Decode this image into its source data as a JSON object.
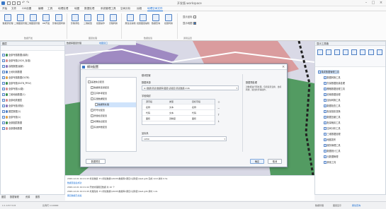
{
  "window": {
    "title": "开发版.workspace"
  },
  "menu": [
    "开始",
    "文件",
    "GIS设置",
    "编辑",
    "工具",
    "地理处理",
    "地图",
    "数据处理",
    "系统管理工具",
    "空间分析",
    "远程",
    "地理空间文件"
  ],
  "ribbon": {
    "buttons": [
      "数据源管理",
      "二维图层管理",
      "三维图层管理",
      "DB开发",
      "影像批量转换",
      "影像调色",
      "三维模型",
      "批量操作",
      "高程转换",
      "属性表编辑",
      "批量图层编辑",
      "数据查询",
      "批量转换"
    ],
    "groups": [
      "数据开发",
      "图层处理",
      "数据加载",
      "通用设置"
    ],
    "checks": [
      {
        "label": "显示坐标",
        "checked": false
      },
      {
        "label": "显示地图",
        "checked": true
      }
    ]
  },
  "left_panel": {
    "title": "图层",
    "items": [
      "全部专题数据(最新)",
      "全部专题(2020_标准)",
      "高程数据(最新)",
      "土地利用数据",
      "全部专题数据(DLTB)",
      "全部专题(DLTB_PRIV)",
      "全部专题(公路)",
      "三维地面数据(1)",
      "全部地类图层",
      "全部专题(规划)",
      "图层数据(1)",
      "全部专题(1)",
      "全部图层数据",
      "全部基础数据"
    ],
    "bottom_tabs": [
      "图层",
      "数据管理",
      "资源",
      "图表"
    ]
  },
  "map_tabs": [
    "数据库图层管理",
    "地图窗口"
  ],
  "right_panel": {
    "title": "显示工具箱",
    "items": [
      "集成数据管理工具",
      "数据转换工具",
      "矢量数据批量处理",
      "栅格数据处理工具",
      "影像数据处理",
      "坐标转换工具",
      "数据检查工具",
      "批量投影变换",
      "数据压缩工具",
      "批量裁剪工具",
      "空间分析工具",
      "三维数据处理",
      "地图发布",
      "服务管理工具",
      "数据统计工具",
      "元数据管理",
      "其他工具"
    ]
  },
  "dialog": {
    "title": "模块配置",
    "list": [
      "基础信息配置",
      "数据库连接配置",
      "空间参考配置",
      "矢量数据配置",
      "数据预处理",
      "符号化配置",
      "质量检查配置",
      "成果输出配置",
      "系统参数配置"
    ],
    "selected": "数据预处理",
    "section_label": "模块配置",
    "source_label": "数据来源",
    "source_value": "G:\\数据\\测试\\数据库\\图层\\试验区\\测试数据.mdb",
    "grid_label": "字段映射",
    "grid_headers": [
      "源字段",
      "类型",
      "目标字段"
    ],
    "grid_rows": [
      [
        "名称",
        "文本",
        "名称"
      ],
      [
        "代码",
        "文本",
        "代码"
      ],
      [
        "面积",
        "双精度",
        "面积"
      ]
    ],
    "bottom_label": "坐标系",
    "bottom_value": "1050",
    "right_label": "数据预处理",
    "right_desc": "对数据进行预处理，包括投影变换、坐标转换、属性检查等操作。",
    "left_button": "数据预览",
    "ok": "确定",
    "cancel": "取消"
  },
  "output": {
    "lines": [
      "2020-12-01 10:21:43 检查数据: E:\\\\测试数据\\\\2020\\\\数据库\\\\图层\\\\试验区\\\\test.gdb 完成 1/10 耗时 0.5s",
      "数据源连接成功",
      "2020-12-01 10:21:44 开始处理图层数据 共 10 个",
      "2020-12-01 10:21:45 处理完成: E:\\\\测试数据\\\\2020\\\\数据库\\\\图层\\\\试验区\\\\test.gdb 用时 1.2s",
      "图层数据已加载"
    ]
  },
  "status": {
    "coords": "1 1 4 8 7 9 8",
    "info": "比例尺 1:10000",
    "right_tabs": [
      "数据管理",
      "图层显示",
      "属性查询"
    ]
  },
  "colors": {
    "accent": "#1a6fd6",
    "map_green": "#3b8f4a",
    "map_red": "#d98c8c",
    "map_purple": "#8b6fb5"
  }
}
